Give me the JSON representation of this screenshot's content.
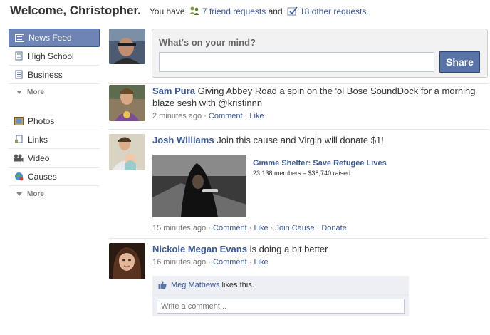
{
  "header": {
    "title": "Welcome, Christopher.",
    "you_have": "You have",
    "friend_requests": "7 friend requests",
    "and": "and",
    "other_requests": "18 other requests",
    "period": "."
  },
  "sidebar": {
    "primary": [
      {
        "label": "News Feed",
        "icon": "news-feed-icon",
        "active": true
      },
      {
        "label": "High School",
        "icon": "network-icon"
      },
      {
        "label": "Business",
        "icon": "network-icon"
      }
    ],
    "more_label": "More",
    "apps": [
      {
        "label": "Photos",
        "icon": "photos-icon"
      },
      {
        "label": "Links",
        "icon": "links-icon"
      },
      {
        "label": "Video",
        "icon": "video-icon"
      },
      {
        "label": "Causes",
        "icon": "causes-icon"
      }
    ]
  },
  "composer": {
    "prompt": "What's on your mind?",
    "input_value": "",
    "share_label": "Share"
  },
  "stories": [
    {
      "actor": "Sam Pura",
      "text": "Giving Abbey Road a spin on the 'ol Bose SoundDock for a morning blaze sesh with @kristinnn",
      "time": "2 minutes ago",
      "sep": "·",
      "comment": "Comment",
      "like": "Like"
    },
    {
      "actor": "Josh Williams",
      "text": "Join this cause and Virgin will donate $1!",
      "attachment_title": "Gimme Shelter: Save Refugee Lives",
      "attachment_sub": "23,138 members – $38,740 raised",
      "time": "15 minutes ago",
      "sep": "·",
      "comment": "Comment",
      "like": "Like",
      "join": "Join Cause",
      "donate": "Donate"
    },
    {
      "actor": "Nickole Megan Evans",
      "text": "is doing a bit better",
      "time": "16 minutes ago",
      "sep": "·",
      "comment": "Comment",
      "like": "Like",
      "liker": "Meg Mathews",
      "likes_this": "likes this.",
      "comment_placeholder": "Write a comment..."
    }
  ],
  "colors": {
    "brand": "#3b5998",
    "active_nav": "#6d84b4",
    "share_button": "#5b74a8",
    "ufi_background": "#edeff4"
  }
}
